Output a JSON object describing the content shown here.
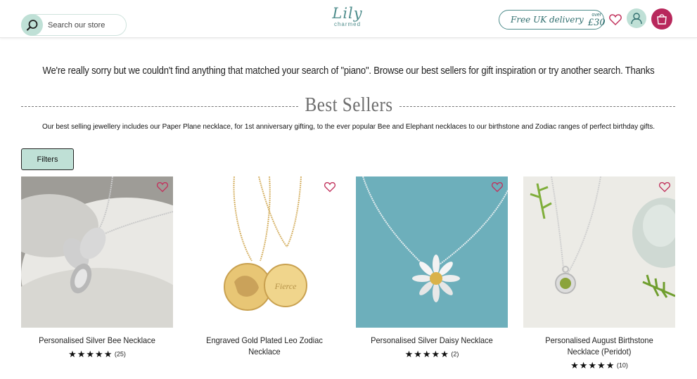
{
  "header": {
    "search_placeholder": "Search our store",
    "logo_main": "Lily",
    "logo_sub": "charmed",
    "delivery_text": "Free UK delivery",
    "delivery_over": "over",
    "delivery_price": "£30"
  },
  "message": "We're really sorry but we couldn't find anything that matched your search of \"piano\". Browse our best sellers for gift inspiration or try another search. Thanks",
  "best_sellers": {
    "title": "Best Sellers",
    "description": "Our best selling jewellery includes our Paper Plane necklace, for 1st anniversary gifting, to the ever popular Bee and Elephant necklaces to our birthstone and Zodiac ranges of perfect birthday gifts."
  },
  "filters_label": "Filters",
  "products": [
    {
      "name": "Personalised Silver Bee Necklace",
      "stars": "★★★★★",
      "reviews": "(25)"
    },
    {
      "name": "Engraved Gold Plated Leo Zodiac Necklace",
      "stars": "",
      "reviews": ""
    },
    {
      "name": "Personalised Silver Daisy Necklace",
      "stars": "★★★★★",
      "reviews": "(2)"
    },
    {
      "name": "Personalised August Birthstone Necklace (Peridot)",
      "stars": "★★★★★",
      "reviews": "(10)"
    }
  ],
  "colors": {
    "accent_mint": "#bfe0d6",
    "brand_teal": "#4f8d8c",
    "bag_magenta": "#b8285c",
    "heart_red": "#c2335d"
  }
}
